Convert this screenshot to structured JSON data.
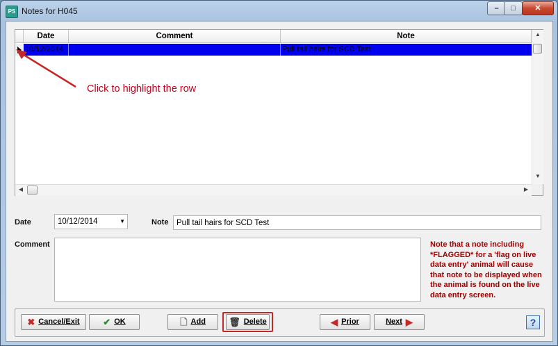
{
  "window": {
    "title": "Notes for H045",
    "app_icon": "PS",
    "controls": {
      "minimize": "–",
      "maximize": "□",
      "close": "✕"
    }
  },
  "grid": {
    "columns": [
      "Date",
      "Comment",
      "Note"
    ],
    "rows": [
      {
        "date": "10/12/2014",
        "comment": "",
        "note": "Pull tail hairs for SCD Test"
      }
    ],
    "selected_row_color": "#0000ee"
  },
  "annotation": {
    "text": "Click to highlight the row",
    "color": "#c0001e"
  },
  "form": {
    "date_label": "Date",
    "date_value": "10/12/2014",
    "note_label": "Note",
    "note_value": "Pull tail hairs for SCD Test",
    "comment_label": "Comment",
    "comment_value": ""
  },
  "notice": "Note that a note including *FLAGGED* for a 'flag on live data entry' animal will cause that note to be displayed when the animal is found on the live data entry screen.",
  "buttons": {
    "cancel": "Cancel/Exit",
    "ok": "OK",
    "add": "Add",
    "delete": "Delete",
    "prior": "Prior",
    "next": "Next",
    "help": "?"
  },
  "icons": {
    "cancel": "red-x-icon",
    "ok": "green-check-icon",
    "add": "new-document-icon",
    "delete": "trash-can-icon",
    "prior": "left-arrow-icon",
    "next": "right-arrow-icon"
  }
}
